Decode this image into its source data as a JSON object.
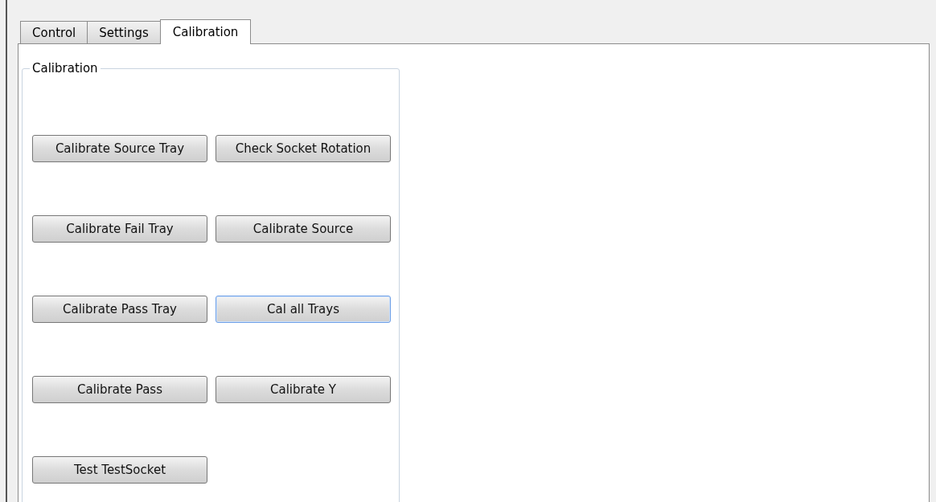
{
  "tabs": [
    {
      "label": "Control",
      "selected": false
    },
    {
      "label": "Settings",
      "selected": false
    },
    {
      "label": "Calibration",
      "selected": true
    }
  ],
  "group": {
    "title": "Calibration",
    "buttons": [
      {
        "label": "Calibrate Source Tray",
        "focused": false
      },
      {
        "label": "Check Socket Rotation",
        "focused": false
      },
      {
        "label": "Calibrate Fail Tray",
        "focused": false
      },
      {
        "label": "Calibrate Source",
        "focused": false
      },
      {
        "label": "Calibrate Pass Tray",
        "focused": false
      },
      {
        "label": "Cal all Trays",
        "focused": true
      },
      {
        "label": "Calibrate Pass",
        "focused": false
      },
      {
        "label": "Calibrate Y",
        "focused": false
      },
      {
        "label": "Test TestSocket",
        "focused": false
      }
    ]
  }
}
